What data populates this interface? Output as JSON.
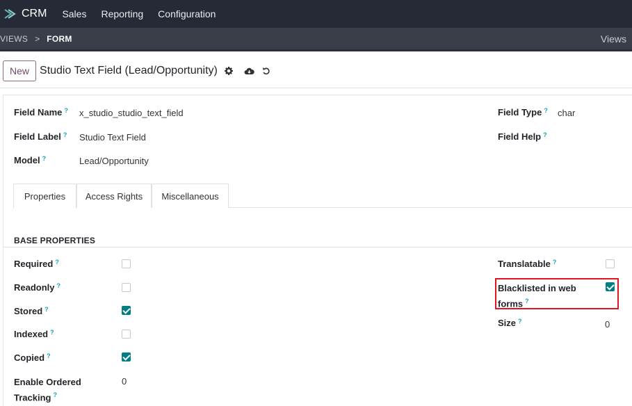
{
  "nav": {
    "brand": "CRM",
    "items": [
      "Sales",
      "Reporting",
      "Configuration"
    ]
  },
  "breadcrumb": {
    "items": [
      "VIEWS",
      "FORM"
    ],
    "separator": ">",
    "right_label": "Views"
  },
  "control": {
    "new_label": "New",
    "record_title": "Studio Text Field (Lead/Opportunity)"
  },
  "fields": {
    "field_name": {
      "label": "Field Name",
      "value": "x_studio_studio_text_field"
    },
    "field_label": {
      "label": "Field Label",
      "value": "Studio Text Field"
    },
    "model": {
      "label": "Model",
      "value": "Lead/Opportunity"
    },
    "field_type": {
      "label": "Field Type",
      "value": "char"
    },
    "field_help": {
      "label": "Field Help",
      "value": ""
    }
  },
  "help_marker": "?",
  "tabs": [
    {
      "label": "Properties",
      "active": true
    },
    {
      "label": "Access Rights",
      "active": false
    },
    {
      "label": "Miscellaneous",
      "active": false
    }
  ],
  "section_title": "BASE PROPERTIES",
  "properties_left": [
    {
      "label": "Required",
      "checked": false
    },
    {
      "label": "Readonly",
      "checked": false
    },
    {
      "label": "Stored",
      "checked": true
    },
    {
      "label": "Indexed",
      "checked": false
    },
    {
      "label": "Copied",
      "checked": true
    },
    {
      "label_line1": "Enable Ordered",
      "label_line2": "Tracking",
      "value": "0"
    }
  ],
  "properties_right": {
    "translatable": {
      "label": "Translatable",
      "checked": false
    },
    "blacklisted": {
      "label_line1": "Blacklisted in web",
      "label_line2": "forms",
      "checked": true
    },
    "size": {
      "label": "Size",
      "value": "0"
    }
  },
  "colors": {
    "topnav": "#262a36",
    "breadcrumb": "#3a3e49",
    "accent_checkbox": "#017e84",
    "highlight": "#e0141e",
    "help": "#17a2b8"
  }
}
